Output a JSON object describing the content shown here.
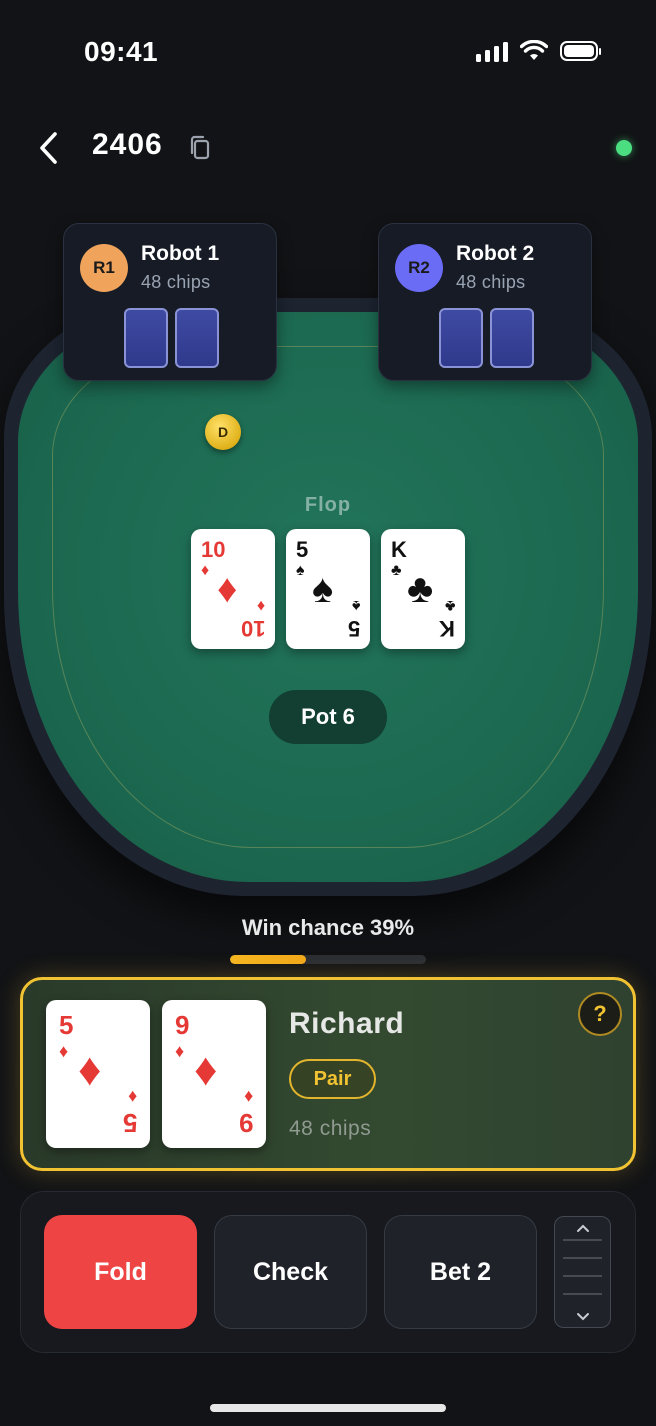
{
  "status_bar": {
    "time": "09:41"
  },
  "header": {
    "room_id": "2406",
    "online": true,
    "online_color": "#4ade80"
  },
  "opponents": [
    {
      "initials": "R1",
      "name": "Robot 1",
      "chips": "48 chips",
      "avatar_color": "#f0a35a"
    },
    {
      "initials": "R2",
      "name": "Robot 2",
      "chips": "48 chips",
      "avatar_color": "#6b6cf6"
    }
  ],
  "dealer_button": "D",
  "board": {
    "stage": "Flop",
    "cards": [
      {
        "rank": "10",
        "suit": "♦",
        "color": "red"
      },
      {
        "rank": "5",
        "suit": "♠",
        "color": "black"
      },
      {
        "rank": "K",
        "suit": "♣",
        "color": "black"
      }
    ]
  },
  "pot": {
    "label": "Pot 6",
    "amount": 6
  },
  "win_chance": {
    "label": "Win chance 39%",
    "percent": 39
  },
  "hero": {
    "name": "Richard",
    "hand": "Pair",
    "chips": "48 chips",
    "help": "?",
    "cards": [
      {
        "rank": "5",
        "suit": "♦",
        "color": "red"
      },
      {
        "rank": "9",
        "suit": "♦",
        "color": "red"
      }
    ]
  },
  "actions": {
    "fold": "Fold",
    "check": "Check",
    "bet": "Bet 2"
  },
  "colors": {
    "accent": "#f1c232",
    "fold": "#ef4444",
    "felt": "#1c6a51"
  }
}
